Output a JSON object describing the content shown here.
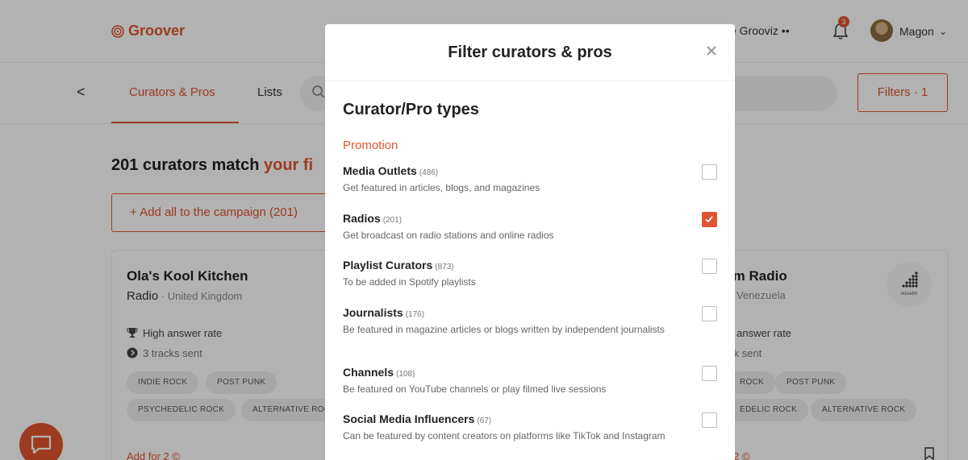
{
  "app": {
    "brand": "Groover",
    "nav_fragment": "e Grooviz ••",
    "notification_count": "3",
    "user_name": "Magon"
  },
  "subnav": {
    "back_label": "<",
    "tab_curators": "Curators & Pros",
    "tab_lists": "Lists",
    "filters_button": "Filters · 1"
  },
  "results": {
    "headline_main": "201 curators match ",
    "headline_accent": "your fi",
    "add_all_button": "+ Add all to the campaign (201)"
  },
  "cards": {
    "left": {
      "title": "Ola's Kool Kitchen",
      "type": "Radio",
      "location": " · United Kingdom",
      "stat_answer": "High answer rate",
      "stat_tracks": "3 tracks sent",
      "tags": [
        "INDIE ROCK",
        "POST PUNK",
        "PSYCHEDELIC ROCK",
        "ALTERNATIVE ROCK"
      ],
      "add_for": "Add for 2 ©"
    },
    "right": {
      "title": "fm Radio",
      "location": "Venezuela",
      "stat_answer": "s answer rate",
      "stat_tracks": "ck sent",
      "tags": [
        "ROCK",
        "POST PUNK",
        "EDELIC ROCK",
        "ALTERNATIVE ROCK"
      ],
      "logo_text": "noisefm",
      "add_for": "2 ©"
    }
  },
  "modal": {
    "title": "Filter curators & pros",
    "section_title": "Curator/Pro types",
    "group_label": "Promotion",
    "options": [
      {
        "name": "Media Outlets",
        "count": "(486)",
        "desc": "Get featured in articles, blogs, and magazines",
        "checked": false
      },
      {
        "name": "Radios",
        "count": "(201)",
        "desc": "Get broadcast on radio stations and online radios",
        "checked": true
      },
      {
        "name": "Playlist Curators",
        "count": "(873)",
        "desc": "To be added in Spotify playlists",
        "checked": false
      },
      {
        "name": "Journalists",
        "count": "(176)",
        "desc": "Be featured in magazine articles or blogs written by independent journalists",
        "checked": false
      },
      {
        "name": "Channels",
        "count": "(108)",
        "desc": "Be featured on YouTube channels or play filmed live sessions",
        "checked": false
      },
      {
        "name": "Social Media Influencers",
        "count": "(67)",
        "desc": "Can be featured by content creators on platforms like TikTok and Instagram",
        "checked": false
      }
    ]
  },
  "colors": {
    "accent": "#e0552f",
    "overlay": "rgba(0,0,0,0.3)"
  }
}
